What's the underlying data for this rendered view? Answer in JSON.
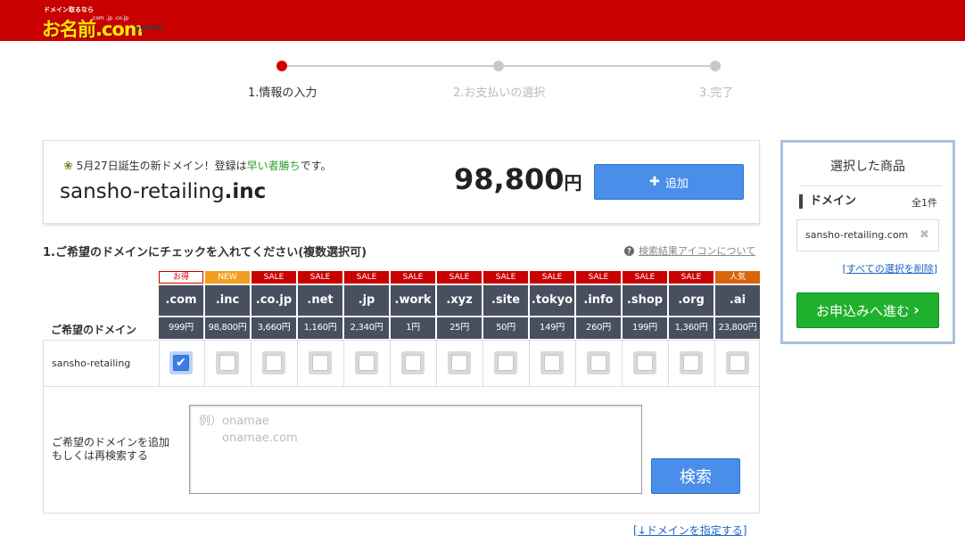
{
  "header": {
    "logo_tagline": "ドメイン取るなら",
    "logo_name": "お名前.com",
    "logo_tlds": ".com .jp .co.jp",
    "logo_company": "byGMO"
  },
  "steps": [
    {
      "label": "1.情報の入力",
      "active": true
    },
    {
      "label": "2.お支払いの選択",
      "active": false
    },
    {
      "label": "3.完了",
      "active": false
    }
  ],
  "featured": {
    "notice_prefix": "5月27日誕生の新ドメイン！登録は",
    "notice_highlight": "早い者勝ち",
    "notice_suffix": "です。",
    "domain_name": "sansho-retailing",
    "domain_tld": ".inc",
    "price": "98,800",
    "price_unit": "円",
    "add_label": "追加",
    "add_icon": "plus-icon"
  },
  "section": {
    "title": "1.ご希望のドメインにチェックを入れてください(複数選択可)",
    "help_link": "検索結果アイコンについて",
    "row_head_label": "ご希望のドメイン"
  },
  "tlds": [
    {
      "badge": "お得",
      "badge_style": "outline",
      "tld": ".com",
      "price": "999円",
      "checked": true
    },
    {
      "badge": "NEW",
      "badge_style": "orange",
      "tld": ".inc",
      "price": "98,800円",
      "checked": false
    },
    {
      "badge": "SALE",
      "badge_style": "red",
      "tld": ".co.jp",
      "price": "3,660円",
      "checked": false
    },
    {
      "badge": "SALE",
      "badge_style": "red",
      "tld": ".net",
      "price": "1,160円",
      "checked": false
    },
    {
      "badge": "SALE",
      "badge_style": "red",
      "tld": ".jp",
      "price": "2,340円",
      "checked": false
    },
    {
      "badge": "SALE",
      "badge_style": "red",
      "tld": ".work",
      "price": "1円",
      "checked": false
    },
    {
      "badge": "SALE",
      "badge_style": "red",
      "tld": ".xyz",
      "price": "25円",
      "checked": false
    },
    {
      "badge": "SALE",
      "badge_style": "red",
      "tld": ".site",
      "price": "50円",
      "checked": false
    },
    {
      "badge": "SALE",
      "badge_style": "red",
      "tld": ".tokyo",
      "price": "149円",
      "checked": false
    },
    {
      "badge": "SALE",
      "badge_style": "red",
      "tld": ".info",
      "price": "260円",
      "checked": false
    },
    {
      "badge": "SALE",
      "badge_style": "red",
      "tld": ".shop",
      "price": "199円",
      "checked": false
    },
    {
      "badge": "SALE",
      "badge_style": "red",
      "tld": ".org",
      "price": "1,360円",
      "checked": false
    },
    {
      "badge": "人気",
      "badge_style": "dark-orange",
      "tld": ".ai",
      "price": "23,800円",
      "checked": false
    }
  ],
  "row": {
    "name": "sansho-retailing"
  },
  "add_domain": {
    "label_line1": "ご希望のドメインを追加",
    "label_line2": "もしくは再検索する",
    "placeholder": "例）onamae\n　　onamae.com",
    "search_label": "検索"
  },
  "bottom_link": {
    "prefix": "[",
    "text": "↓ドメインを指定する",
    "suffix": "]"
  },
  "side": {
    "title": "選択した商品",
    "category": "ドメイン",
    "count": "全1件",
    "item": "sansho-retailing.com",
    "remove_icon": "close-icon",
    "clear_prefix": "[",
    "clear_text": "すべての選択を削除",
    "clear_suffix": "]",
    "proceed_label": "お申込みへ進む",
    "proceed_icon": "chevron-right-icon"
  },
  "colors": {
    "header": "#c90000",
    "blue_button": "#4a8ee9",
    "green_button": "#1fb12e",
    "tld_header": "#484f5e",
    "badge_red": "#c90000",
    "badge_orange": "#f0a01e",
    "badge_dark_orange": "#d9650a",
    "step_active": "#d40000"
  }
}
